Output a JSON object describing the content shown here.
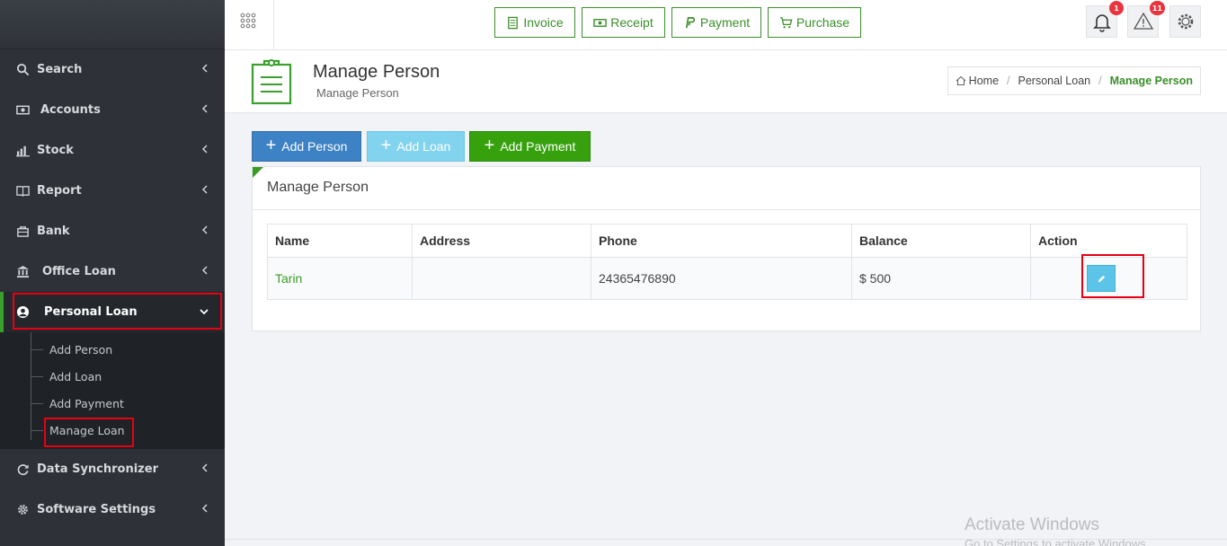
{
  "sidebar": {
    "items": [
      {
        "label": "Search",
        "icon": "search-icon"
      },
      {
        "label": "Accounts",
        "icon": "money-icon"
      },
      {
        "label": "Stock",
        "icon": "bar-chart-icon"
      },
      {
        "label": "Report",
        "icon": "book-icon"
      },
      {
        "label": "Bank",
        "icon": "bank-icon"
      },
      {
        "label": "Office Loan",
        "icon": "building-icon"
      },
      {
        "label": "Personal Loan",
        "icon": "person-icon"
      },
      {
        "label": "Data Synchronizer",
        "icon": "sync-icon"
      },
      {
        "label": "Software Settings",
        "icon": "gear-icon"
      }
    ],
    "submenu": [
      "Add Person",
      "Add Loan",
      "Add Payment",
      "Manage Loan"
    ]
  },
  "topbar": {
    "quick_buttons": [
      "Invoice",
      "Receipt",
      "Payment",
      "Purchase"
    ],
    "notifications_count": "1",
    "alerts_count": "11"
  },
  "page": {
    "title": "Manage Person",
    "subtitle": "Manage Person"
  },
  "breadcrumb": {
    "home": "Home",
    "section": "Personal Loan",
    "current": "Manage Person"
  },
  "actions": {
    "add_person": "Add Person",
    "add_loan": "Add Loan",
    "add_payment": "Add Payment"
  },
  "panel": {
    "title": "Manage Person",
    "columns": [
      "Name",
      "Address",
      "Phone",
      "Balance",
      "Action"
    ],
    "rows": [
      {
        "name": "Tarin",
        "address": "",
        "phone": "24365476890",
        "balance": "$ 500"
      }
    ]
  },
  "watermark": {
    "line1": "Activate Windows",
    "line2": "Go to Settings to activate Windows."
  },
  "colors": {
    "accent_green": "#3a8f2a",
    "sidebar_bg": "#2e3238",
    "highlight_red": "#e60012"
  }
}
